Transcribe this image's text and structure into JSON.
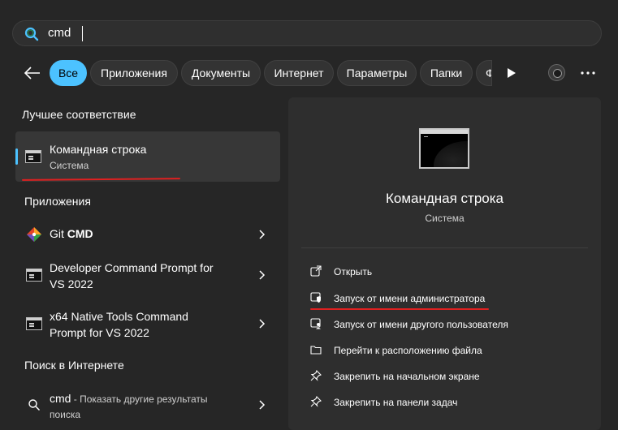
{
  "search": {
    "query": "cmd"
  },
  "filters": {
    "items": [
      {
        "label": "Все",
        "active": true
      },
      {
        "label": "Приложения"
      },
      {
        "label": "Документы"
      },
      {
        "label": "Интернет"
      },
      {
        "label": "Параметры"
      },
      {
        "label": "Папки"
      },
      {
        "label": "Ф"
      }
    ]
  },
  "best_match": {
    "header": "Лучшее соответствие",
    "title": "Командная строка",
    "subtitle": "Система"
  },
  "apps": {
    "header": "Приложения",
    "items": [
      {
        "name_prefix": "Git ",
        "name_bold": "CMD"
      },
      {
        "line1": "Developer Command Prompt for",
        "line2": "VS 2022"
      },
      {
        "line1": "x64 Native Tools Command",
        "line2": "Prompt for VS 2022"
      }
    ]
  },
  "web": {
    "header": "Поиск в Интернете",
    "query": "cmd",
    "suffix": " - Показать другие результаты",
    "line2": "поиска"
  },
  "details": {
    "title": "Командная строка",
    "subtitle": "Система",
    "actions": [
      {
        "label": "Открыть",
        "icon": "open-external-icon"
      },
      {
        "label": "Запуск от имени администратора",
        "icon": "admin-shield-icon"
      },
      {
        "label": "Запуск от имени другого пользователя",
        "icon": "user-switch-icon"
      },
      {
        "label": "Перейти к расположению файла",
        "icon": "folder-icon"
      },
      {
        "label": "Закрепить на начальном экране",
        "icon": "pin-icon"
      },
      {
        "label": "Закрепить на панели задач",
        "icon": "pin-icon"
      }
    ]
  },
  "colors": {
    "accent": "#4cc2ff",
    "underline": "#e02020",
    "background": "#262626"
  }
}
